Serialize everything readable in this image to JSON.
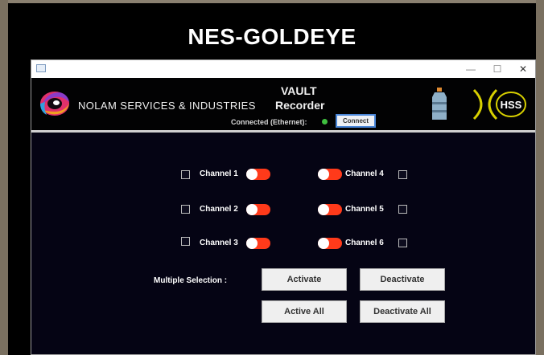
{
  "banner": {
    "title": "NES-GOLDEYE"
  },
  "window": {
    "titlebar": {
      "minimize": "—",
      "maximize": "☐",
      "close": "✕"
    },
    "header": {
      "company": "NOLAM SERVICES & INDUSTRIES",
      "app_line1": "VAULT",
      "app_line2": "Recorder",
      "connection_status": "Connected (Ethernet):",
      "connect_button": "Connect",
      "brand_logo_text": "HSS"
    },
    "channels": [
      {
        "label": "Channel 1",
        "checked": false,
        "toggle": "on"
      },
      {
        "label": "Channel 2",
        "checked": false,
        "toggle": "on"
      },
      {
        "label": "Channel 3",
        "checked": false,
        "toggle": "on"
      },
      {
        "label": "Channel 4",
        "checked": false,
        "toggle": "on"
      },
      {
        "label": "Channel 5",
        "checked": false,
        "toggle": "on"
      },
      {
        "label": "Channel 6",
        "checked": false,
        "toggle": "on"
      }
    ],
    "multiple_selection": {
      "label": "Multiple Selection :",
      "activate": "Activate",
      "deactivate": "Deactivate",
      "active_all": "Active All",
      "deactivate_all": "Deactivate All"
    },
    "colors": {
      "toggle_track": "#ff3a1a",
      "status_led": "#3fbf3f",
      "background": "#050414"
    }
  }
}
